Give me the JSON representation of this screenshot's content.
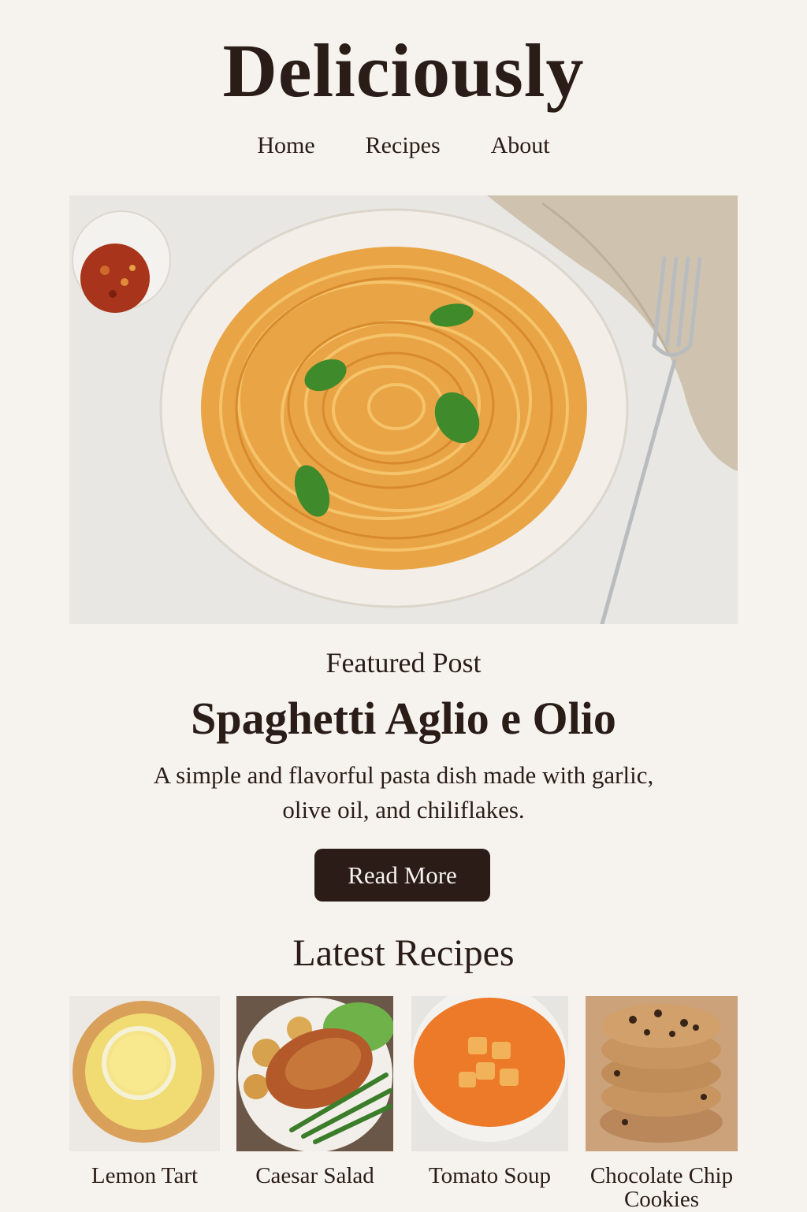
{
  "site": {
    "brand": "Deliciously"
  },
  "nav": {
    "items": [
      {
        "label": "Home"
      },
      {
        "label": "Recipes"
      },
      {
        "label": "About"
      }
    ]
  },
  "featured": {
    "eyebrow": "Featured Post",
    "title": "Spaghetti Aglio e Olio",
    "description": "A simple and flavorful pasta dish made with garlic, olive oil, and chiliflakes.",
    "button_label": "Read More",
    "image_icon": "spaghetti-bowl-photo"
  },
  "latest": {
    "heading": "Latest Recipes",
    "recipes": [
      {
        "name": "Lemon Tart",
        "image_icon": "lemon-tart-photo"
      },
      {
        "name": "Caesar Salad",
        "image_icon": "caesar-salad-photo"
      },
      {
        "name": "Tomato Soup",
        "image_icon": "tomato-soup-photo"
      },
      {
        "name": "Chocolate Chip Cookies",
        "image_icon": "cookies-photo"
      }
    ]
  },
  "colors": {
    "background": "#f6f3ee",
    "text": "#2a1c17",
    "button": "#2b1c18"
  }
}
